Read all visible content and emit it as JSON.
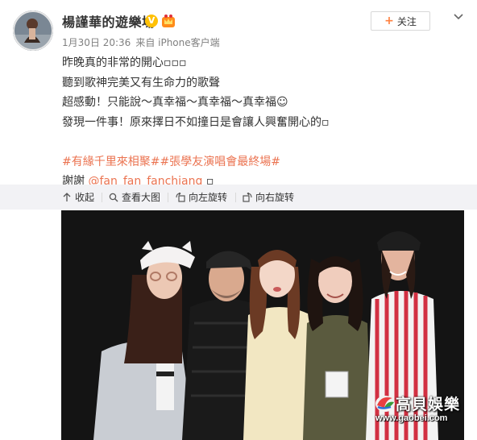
{
  "author": {
    "name": "楊謹華的遊樂場",
    "verified_badge": "V"
  },
  "header": {
    "follow_label": "关注",
    "follow_plus": "+"
  },
  "meta": {
    "time": "1月30日 20:36",
    "source": "来自 iPhone客户端"
  },
  "post": {
    "lines": [
      "昨晚真的非常的開心▫▫▫",
      "聽到歌神完美又有生命力的歌聲",
      "超感動！只能說～真幸福～真幸福～真幸福☺",
      "發現一件事！原來擇日不如撞日是會讓人興奮開心的▫"
    ],
    "topics": "#有緣千里來相聚##張學友演唱會最終場#",
    "thanks": "謝謝",
    "mention": "@fan_fan_fanchiang",
    "thanks_tail": "▫"
  },
  "toolbar": {
    "collapse": "收起",
    "view_large": "查看大图",
    "rotate_left": "向左旋转",
    "rotate_right": "向右旋转"
  },
  "watermark": {
    "title": "高貝娛樂",
    "url": "www.gaobei.com"
  },
  "colors": {
    "accent": "#eb7350",
    "toolbar_bg": "#f2f2f5",
    "verified": "#ffc107"
  }
}
